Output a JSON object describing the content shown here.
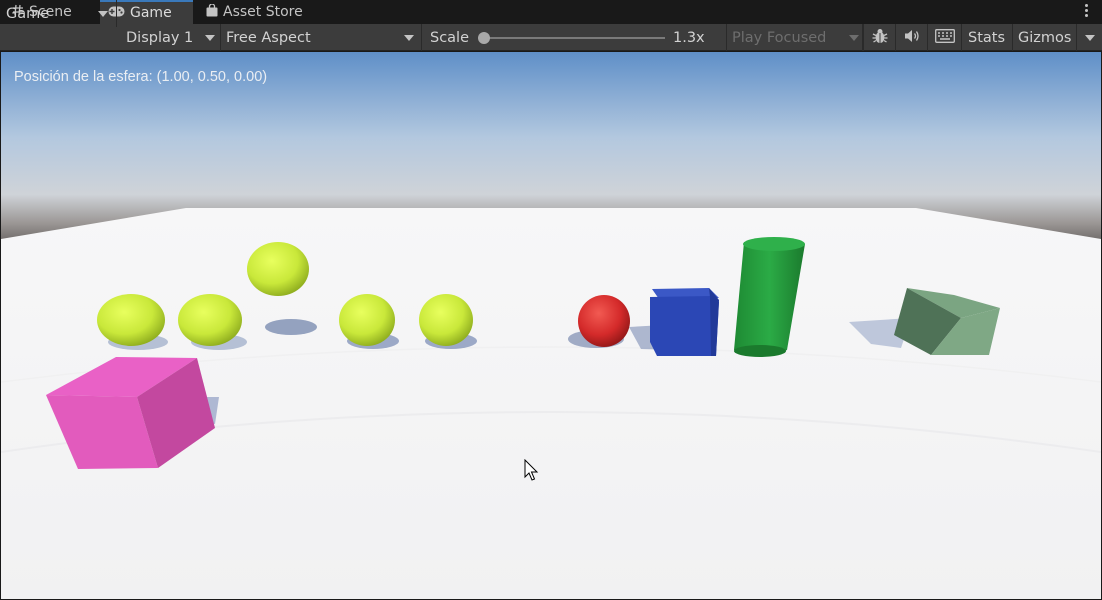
{
  "tabs": [
    {
      "label": "Scene",
      "icon": "hash-icon"
    },
    {
      "label": "Game",
      "icon": "gamepad-icon",
      "active": true
    },
    {
      "label": "Asset Store",
      "icon": "shopping-bag-icon"
    }
  ],
  "toolbar": {
    "view_mode": "Game",
    "display": "Display 1",
    "aspect": "Free Aspect",
    "scale_label": "Scale",
    "scale_value": "1.3x",
    "play_mode": "Play Focused",
    "stats_label": "Stats",
    "gizmos_label": "Gizmos"
  },
  "game_view": {
    "overlay_text": "Posición de la esfera: (1.00, 0.50, 0.00)"
  },
  "colors": {
    "accent": "#3a79bb",
    "panel": "#3c3c3c",
    "tabbar": "#191919",
    "yellow_sphere": "#c9e83a",
    "red_sphere": "#d42a2a",
    "blue_cube": "#2b47b5",
    "green_cylinder": "#249a3b",
    "sage_cube": "#6f9a75",
    "pink_cube": "#e25bbd"
  }
}
